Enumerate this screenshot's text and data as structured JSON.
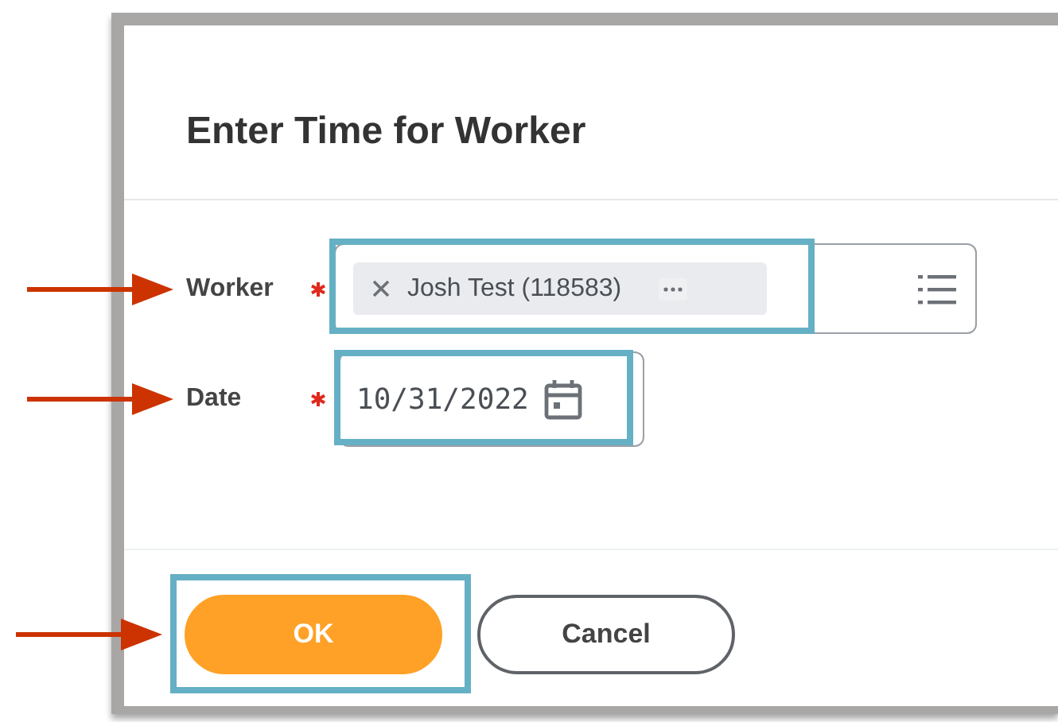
{
  "dialog": {
    "title": "Enter Time for Worker"
  },
  "fields": [
    {
      "kind": "prompt",
      "label": "Worker",
      "required": true,
      "value": "Josh Test (118583)",
      "highlighted": true
    },
    {
      "kind": "date",
      "label": "Date",
      "required": true,
      "value": "10/31/2022",
      "highlighted": true
    }
  ],
  "buttons": [
    {
      "kind": "primary",
      "label": "OK",
      "highlighted": true
    },
    {
      "kind": "secondary",
      "label": "Cancel",
      "highlighted": false
    }
  ]
}
